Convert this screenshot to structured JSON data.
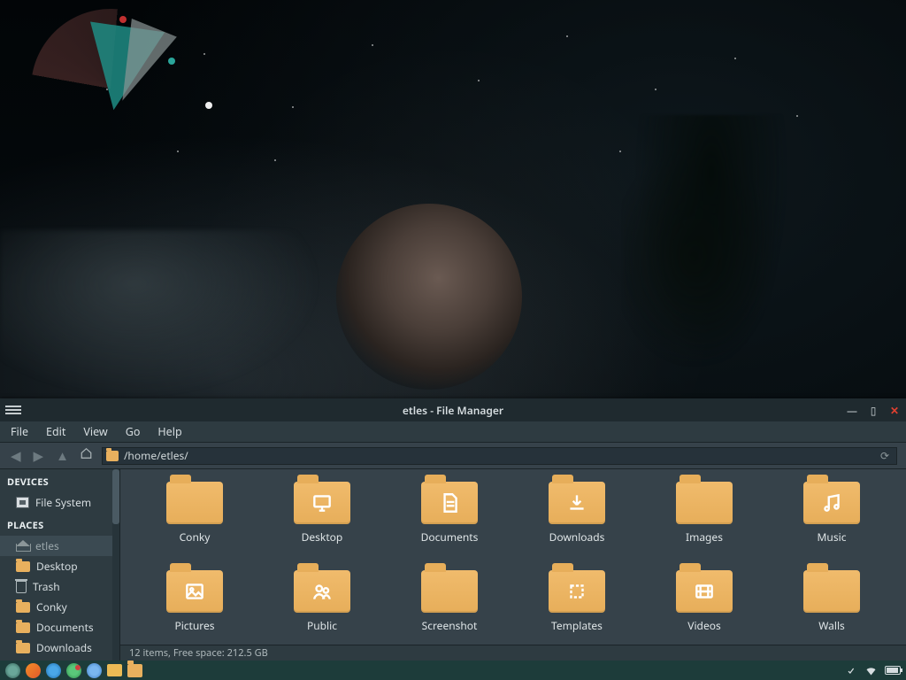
{
  "window": {
    "title": "etles - File Manager",
    "menus": {
      "file": "File",
      "edit": "Edit",
      "view": "View",
      "go": "Go",
      "help": "Help"
    },
    "path": "/home/etles/"
  },
  "sidebar": {
    "sections": {
      "devices": {
        "header": "DEVICES",
        "items": [
          {
            "label": "File System"
          }
        ]
      },
      "places": {
        "header": "PLACES",
        "items": [
          {
            "label": "etles"
          },
          {
            "label": "Desktop"
          },
          {
            "label": "Trash"
          },
          {
            "label": "Conky"
          },
          {
            "label": "Documents"
          },
          {
            "label": "Downloads"
          }
        ]
      }
    }
  },
  "folders": [
    {
      "label": "Conky"
    },
    {
      "label": "Desktop"
    },
    {
      "label": "Documents"
    },
    {
      "label": "Downloads"
    },
    {
      "label": "Images"
    },
    {
      "label": "Music"
    },
    {
      "label": "Pictures"
    },
    {
      "label": "Public"
    },
    {
      "label": "Screenshot"
    },
    {
      "label": "Templates"
    },
    {
      "label": "Videos"
    },
    {
      "label": "Walls"
    }
  ],
  "status": "12 items, Free space: 212.5 GB",
  "colors": {
    "folder": "#e8b05e",
    "panel": "#2e3b41",
    "content": "#36424a",
    "taskbar": "#1d3c3a"
  }
}
